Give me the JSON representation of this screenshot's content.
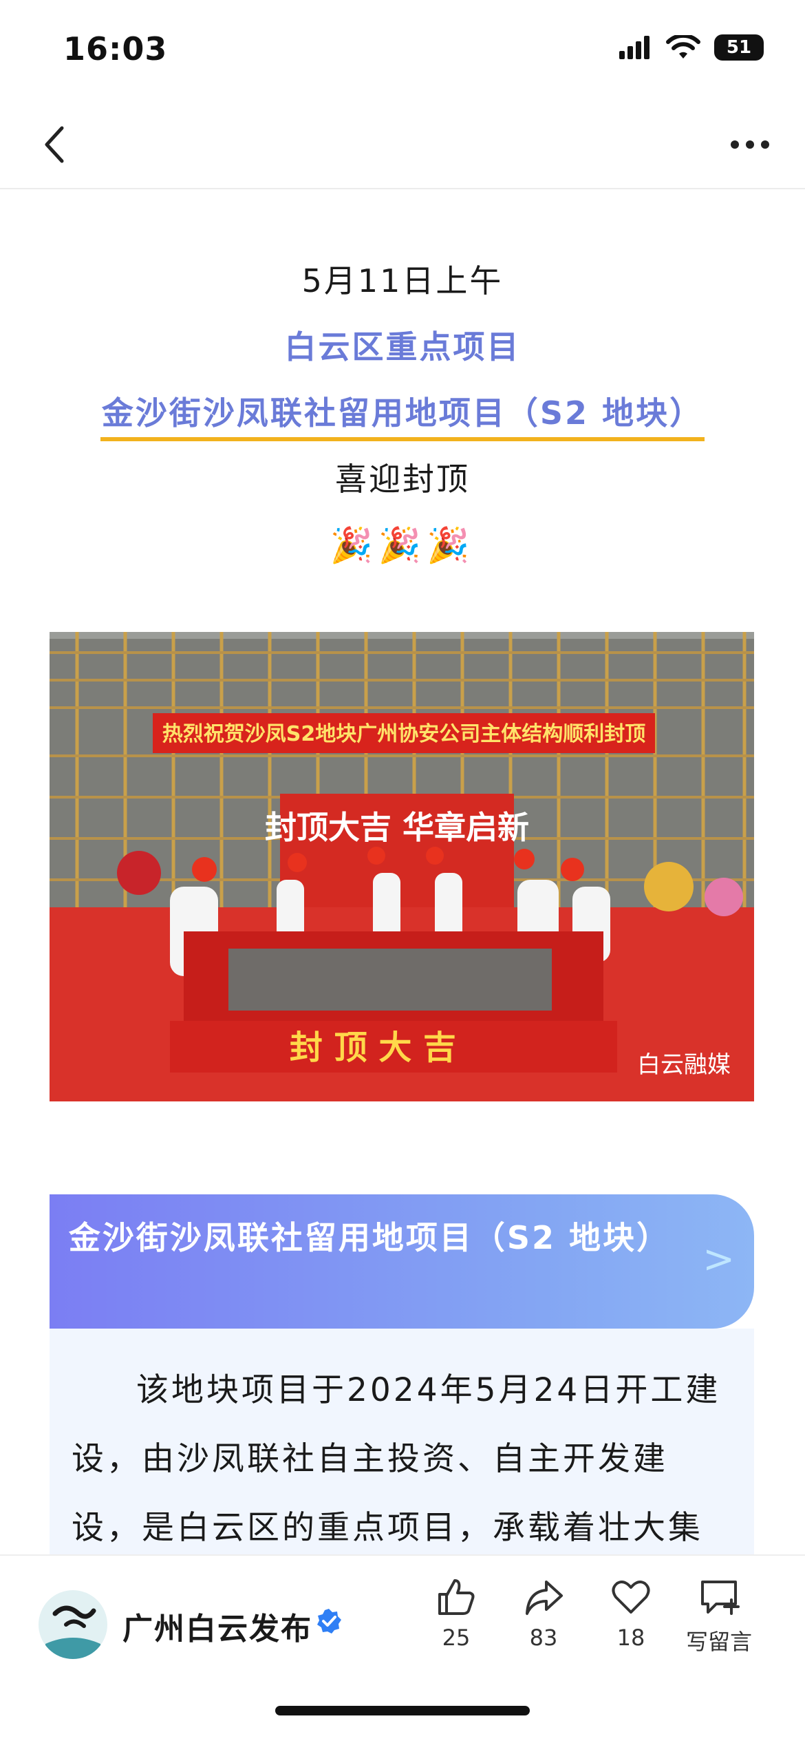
{
  "status_bar": {
    "time": "16:03",
    "battery_level": "51"
  },
  "nav": {
    "back_icon": "chevron-left-icon",
    "more_icon": "more-dots-icon"
  },
  "intro": {
    "date_line": "5月11日上午",
    "project_category": "白云区重点项目",
    "project_name": "金沙街沙凤联社留用地项目（S2 地块）",
    "celebration_text": "喜迎封顶",
    "emoji": "🎉🎉🎉"
  },
  "photo": {
    "banner_text": "热烈祝贺沙凤S2地块广州协安公司主体结构顺利封顶",
    "stage_text": "封顶大吉 华章启新",
    "pit_text": "封 顶 大 吉",
    "watermark": "白云融媒"
  },
  "section": {
    "title": "金沙街沙凤联社留用地项目（S2 地块）",
    "body": "该地块项目于2024年5月24日开工建设，由沙凤联社自主投资、自主开发建设，是白云区的重点项目，承载着壮大集"
  },
  "account": {
    "name": "广州白云发布",
    "verified_icon": "verified-badge-icon"
  },
  "actions": {
    "like_count": "25",
    "share_count": "83",
    "favorite_count": "18",
    "comment_label": "写留言"
  },
  "colors": {
    "accent_blue": "#6a7bd8",
    "underline_yellow": "#f2b21d",
    "verified_blue": "#2f7ff5"
  }
}
